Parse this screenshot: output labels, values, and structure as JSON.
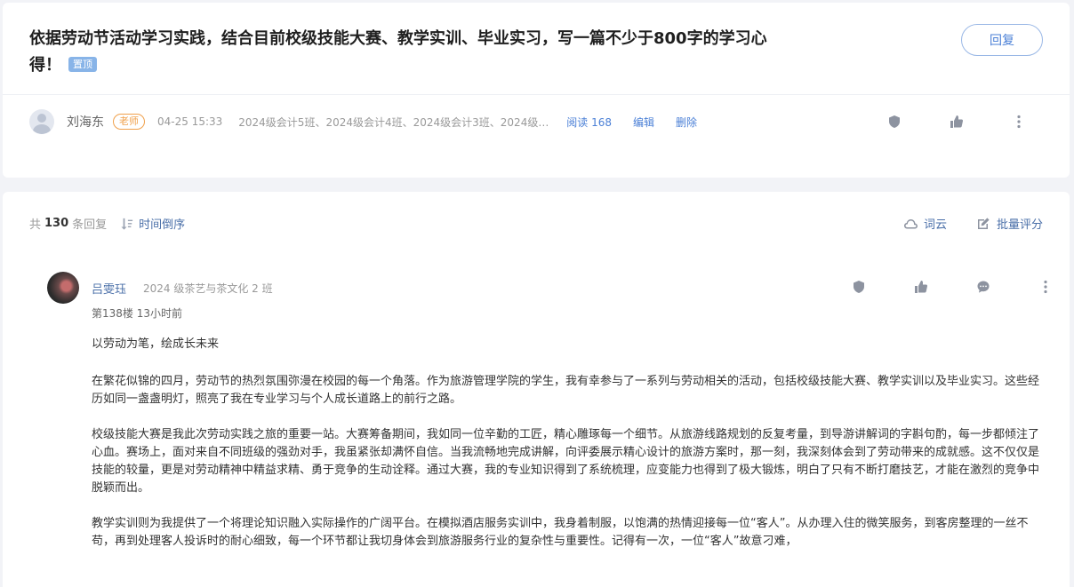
{
  "post": {
    "title": "依据劳动节活动学习实践，结合目前校级技能大赛、教学实训、毕业实习，写一篇不少于800字的学习心得！",
    "pin_label": "置顶",
    "reply_button": "回复",
    "author": "刘海东",
    "role": "老师",
    "time": "04-25 15:33",
    "classes": "2024级会计5班、2024级会计4班、2024级会计3班、2024级会计2...",
    "reads": "阅读 168",
    "edit": "编辑",
    "delete": "删除"
  },
  "list": {
    "count_prefix": "共",
    "count": "130",
    "count_suffix": "条回复",
    "sort": "时间倒序",
    "word_cloud": "词云",
    "batch_score": "批量评分"
  },
  "reply": {
    "name": "吕雯珏",
    "class": "2024 级茶艺与茶文化 2 班",
    "floor_time": "第138楼   13小时前",
    "paragraphs": [
      "以劳动为笔，绘成长未来",
      "在繁花似锦的四月，劳动节的热烈氛围弥漫在校园的每一个角落。作为旅游管理学院的学生，我有幸参与了一系列与劳动相关的活动，包括校级技能大赛、教学实训以及毕业实习。这些经历如同一盏盏明灯，照亮了我在专业学习与个人成长道路上的前行之路。",
      "校级技能大赛是我此次劳动实践之旅的重要一站。大赛筹备期间，我如同一位辛勤的工匠，精心雕琢每一个细节。从旅游线路规划的反复考量，到导游讲解词的字斟句酌，每一步都倾注了心血。赛场上，面对来自不同班级的强劲对手，我虽紧张却满怀自信。当我流畅地完成讲解，向评委展示精心设计的旅游方案时，那一刻，我深刻体会到了劳动带来的成就感。这不仅仅是技能的较量，更是对劳动精神中精益求精、勇于竞争的生动诠释。通过大赛，我的专业知识得到了系统梳理，应变能力也得到了极大锻炼，明白了只有不断打磨技艺，才能在激烈的竞争中脱颖而出。",
      "教学实训则为我提供了一个将理论知识融入实际操作的广阔平台。在模拟酒店服务实训中，我身着制服，以饱满的热情迎接每一位“客人”。从办理入住的微笑服务，到客房整理的一丝不苟，再到处理客人投诉时的耐心细致，每一个环节都让我切身体会到旅游服务行业的复杂性与重要性。记得有一次，一位“客人”故意刁难，"
    ]
  },
  "icons": {
    "meta": [
      "shield-icon",
      "thumb-up-icon",
      "more-vertical-icon"
    ],
    "list_head": [
      "sort-icon",
      "cloud-icon",
      "edit-square-icon"
    ],
    "reply": [
      "shield-icon",
      "thumb-up-icon",
      "comment-icon",
      "more-vertical-icon"
    ]
  }
}
